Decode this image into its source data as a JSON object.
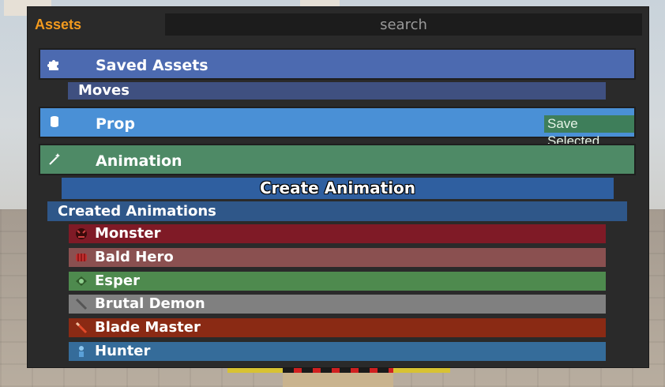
{
  "panel": {
    "title": "Assets",
    "search_placeholder": "search"
  },
  "sections": {
    "saved_assets": {
      "label": "Saved Assets",
      "icon": "puzzle-piece-icon"
    },
    "moves": {
      "label": "Moves"
    },
    "prop": {
      "label": "Prop",
      "icon": "cylinder-icon",
      "save_selected": "Save Selected"
    },
    "animation": {
      "label": "Animation",
      "icon": "magic-wand-icon"
    },
    "create_animation": {
      "label": "Create Animation"
    },
    "created_animations": {
      "label": "Created Animations"
    }
  },
  "animations": [
    {
      "label": "Monster",
      "color": "#7f1a26",
      "icon": "monster-icon"
    },
    {
      "label": "Bald Hero",
      "color": "#8a5050",
      "icon": "fist-icon"
    },
    {
      "label": "Esper",
      "color": "#4e8a4e",
      "icon": "esper-icon"
    },
    {
      "label": "Brutal Demon",
      "color": "#808080",
      "icon": "sword-icon"
    },
    {
      "label": "Blade Master",
      "color": "#8a2a14",
      "icon": "blade-icon"
    },
    {
      "label": "Hunter",
      "color": "#356c9a",
      "icon": "hunter-icon"
    }
  ],
  "colors": {
    "title_accent": "#f39a1e",
    "saved_assets_bg": "#4c6ab0",
    "prop_bg": "#4a90d6",
    "animation_bg": "#4e8a66"
  }
}
